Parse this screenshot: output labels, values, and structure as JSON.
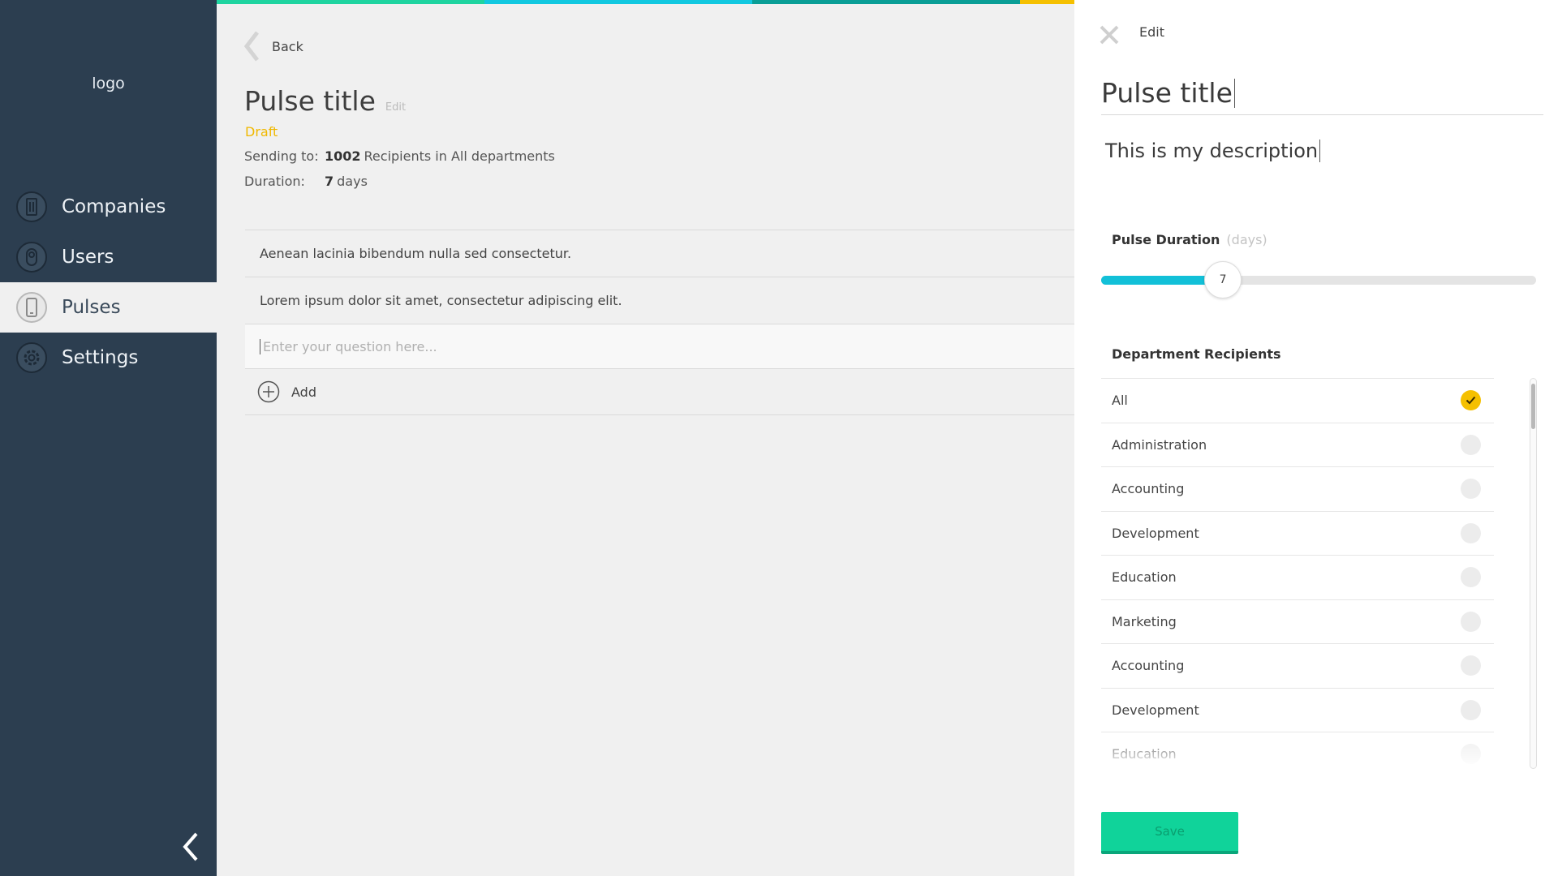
{
  "sidebar": {
    "logo": "logo",
    "items": [
      {
        "label": "Companies",
        "icon": "building-icon",
        "active": false
      },
      {
        "label": "Users",
        "icon": "user-icon",
        "active": false
      },
      {
        "label": "Pulses",
        "icon": "phone-icon",
        "active": true
      },
      {
        "label": "Settings",
        "icon": "gear-icon",
        "active": false
      }
    ],
    "collapse_icon": "chevron-left-icon"
  },
  "topbar": {
    "segments": [
      "#1fd4a0",
      "#12c8e0",
      "#0a9e96",
      "#f5c000"
    ]
  },
  "main": {
    "back_label": "Back",
    "pulse_title": "Pulse title",
    "edit_label": "Edit",
    "status": "Draft",
    "sending_label": "Sending to:",
    "sending_count": "1002",
    "sending_rest": "Recipients in All departments",
    "duration_label": "Duration:",
    "duration_value": "7",
    "duration_unit": "days",
    "questions": [
      "Aenean lacinia bibendum nulla sed consectetur.",
      "Lorem ipsum dolor sit amet, consectetur adipiscing elit."
    ],
    "question_placeholder": "Enter your question here...",
    "add_label": "Add"
  },
  "panel": {
    "header": "Edit",
    "title_value": "Pulse title",
    "description_value": "This is my description",
    "duration_label": "Pulse Duration",
    "duration_unit": "(days)",
    "duration_value": "7",
    "duration_fraction": 0.28,
    "recipients_label": "Department Recipients",
    "departments": [
      {
        "label": "All",
        "checked": true
      },
      {
        "label": "Administration",
        "checked": false
      },
      {
        "label": "Accounting",
        "checked": false
      },
      {
        "label": "Development",
        "checked": false
      },
      {
        "label": "Education",
        "checked": false
      },
      {
        "label": "Marketing",
        "checked": false
      },
      {
        "label": "Accounting",
        "checked": false
      },
      {
        "label": "Development",
        "checked": false
      },
      {
        "label": "Education",
        "checked": false
      }
    ],
    "save_label": "Save",
    "accent": "#12c0d8",
    "check_color": "#f5c000",
    "save_color": "#10d39a"
  }
}
